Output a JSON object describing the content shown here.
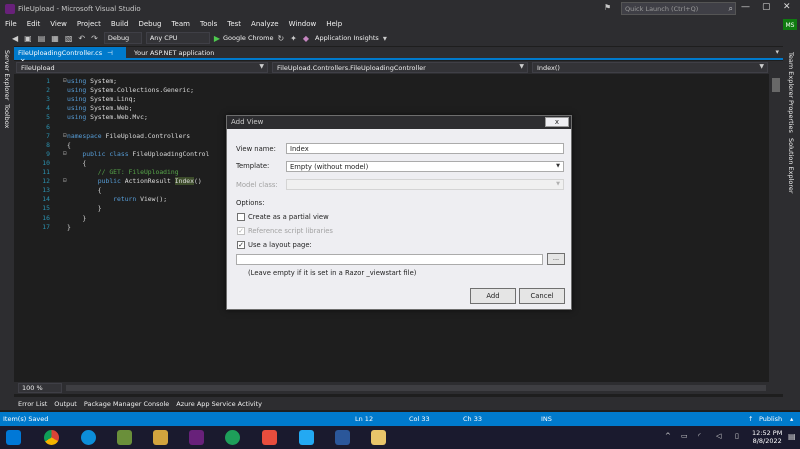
{
  "window": {
    "title": "FileUpload - Microsoft Visual Studio",
    "quick_launch_placeholder": "Quick Launch (Ctrl+Q)",
    "account_initials": "MS"
  },
  "menu": [
    "File",
    "Edit",
    "View",
    "Project",
    "Build",
    "Debug",
    "Team",
    "Tools",
    "Test",
    "Analyze",
    "Window",
    "Help"
  ],
  "toolbar": {
    "config": "Debug",
    "platform": "Any CPU",
    "browser": "Google Chrome",
    "insights": "Application Insights"
  },
  "left_panels": [
    "Server Explorer",
    "Toolbox"
  ],
  "right_panels": [
    "Team Explorer",
    "Properties",
    "Solution Explorer"
  ],
  "doc_tabs": [
    "FileUploadingController.cs",
    "Your ASP.NET application"
  ],
  "navbar": {
    "project": "FileUpload",
    "class": "FileUpload.Controllers.FileUploadingController",
    "member": "Index()"
  },
  "code_lines": [
    {
      "n": "1",
      "segs": [
        {
          "t": "using ",
          "c": "kw"
        },
        {
          "t": "System;",
          "c": "ns"
        }
      ]
    },
    {
      "n": "2",
      "segs": [
        {
          "t": "using ",
          "c": "kw"
        },
        {
          "t": "System.Collections.Generic;",
          "c": "ns"
        }
      ]
    },
    {
      "n": "3",
      "segs": [
        {
          "t": "using ",
          "c": "kw"
        },
        {
          "t": "System.Linq;",
          "c": "ns"
        }
      ]
    },
    {
      "n": "4",
      "segs": [
        {
          "t": "using ",
          "c": "kw"
        },
        {
          "t": "System.Web;",
          "c": "ns"
        }
      ]
    },
    {
      "n": "5",
      "segs": [
        {
          "t": "using ",
          "c": "kw"
        },
        {
          "t": "System.Web.Mvc;",
          "c": "ns"
        }
      ]
    },
    {
      "n": "6",
      "segs": []
    },
    {
      "n": "7",
      "segs": [
        {
          "t": "namespace ",
          "c": "kw"
        },
        {
          "t": "FileUpload.Controllers",
          "c": "ns"
        }
      ]
    },
    {
      "n": "8",
      "segs": [
        {
          "t": "{",
          "c": "ns"
        }
      ]
    },
    {
      "n": "9",
      "segs": [
        {
          "t": "    public class ",
          "c": "kw"
        },
        {
          "t": "FileUploadingControl",
          "c": "ns"
        }
      ]
    },
    {
      "n": "10",
      "segs": [
        {
          "t": "    {",
          "c": "ns"
        }
      ]
    },
    {
      "n": "11",
      "segs": [
        {
          "t": "        // GET: FileUploading",
          "c": "cm"
        }
      ]
    },
    {
      "n": "12",
      "segs": [
        {
          "t": "        public ",
          "c": "kw"
        },
        {
          "t": "ActionResult ",
          "c": "ns"
        },
        {
          "t": "Index",
          "c": "hl"
        },
        {
          "t": "()",
          "c": "ns"
        }
      ]
    },
    {
      "n": "13",
      "segs": [
        {
          "t": "        {",
          "c": "ns"
        }
      ]
    },
    {
      "n": "14",
      "segs": [
        {
          "t": "            return ",
          "c": "kw"
        },
        {
          "t": "View();",
          "c": "ns"
        }
      ]
    },
    {
      "n": "15",
      "segs": [
        {
          "t": "        }",
          "c": "ns"
        }
      ]
    },
    {
      "n": "16",
      "segs": [
        {
          "t": "    }",
          "c": "ns"
        }
      ]
    },
    {
      "n": "17",
      "segs": [
        {
          "t": "}",
          "c": "ns"
        }
      ]
    }
  ],
  "zoom": "100 %",
  "dialog": {
    "title": "Add View",
    "view_name_label": "View name:",
    "view_name_value": "Index",
    "template_label": "Template:",
    "template_value": "Empty (without model)",
    "model_class_label": "Model class:",
    "options_label": "Options:",
    "partial_label": "Create as a partial view",
    "partial_checked": false,
    "reference_label": "Reference script libraries",
    "reference_checked": true,
    "layout_label": "Use a layout page:",
    "layout_checked": true,
    "layout_value": "",
    "browse_label": "...",
    "hint": "(Leave empty if it is set in a Razor _viewstart file)",
    "add_label": "Add",
    "cancel_label": "Cancel",
    "close_label": "x"
  },
  "bottom_tabs": [
    "Error List",
    "Output",
    "Package Manager Console",
    "Azure App Service Activity"
  ],
  "status": {
    "message": "Item(s) Saved",
    "ln": "Ln 12",
    "col": "Col 33",
    "ch": "Ch 33",
    "mode": "INS",
    "publish": "Publish"
  },
  "taskbar": {
    "time": "12:52 PM",
    "date": "8/8/2022"
  },
  "colors": {
    "accent": "#007acc",
    "editor_bg": "#1e1e1e",
    "chrome_bg": "#2d2d30"
  }
}
